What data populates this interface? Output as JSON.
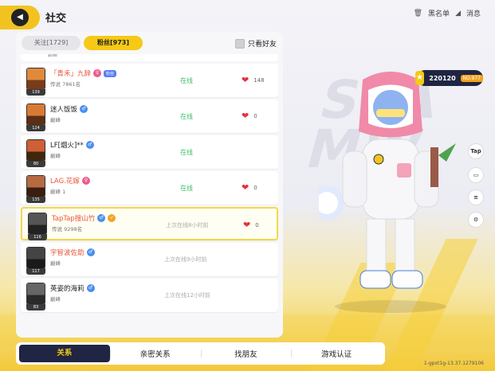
{
  "header": {
    "title": "社交",
    "blacklist_label": "黑名单",
    "messages_label": "消息"
  },
  "tabs": [
    {
      "label": "关注[1729]",
      "active": false
    },
    {
      "label": "粉丝[973]",
      "active": true
    }
  ],
  "friends_only_label": "只看好友",
  "partial_row": {
    "rank": "巅峰"
  },
  "rows": [
    {
      "name": "「青禾」九辞",
      "gender": "female",
      "badge": "粉丝",
      "level": "139",
      "rank": "传说 7861名",
      "status": "在线",
      "online": true,
      "likes": "148",
      "avatar_color": "#e08a3c",
      "name_color": "orange"
    },
    {
      "name": "迷人饭饭",
      "gender": "male",
      "badge": "",
      "level": "124",
      "rank": "巅峰",
      "status": "在线",
      "online": true,
      "likes": "0",
      "avatar_color": "#d97a34",
      "name_color": "dark"
    },
    {
      "name": "LF[烟火]**",
      "gender": "male",
      "badge": "",
      "level": "80",
      "rank": "巅峰",
      "status": "在线",
      "online": true,
      "likes": "",
      "avatar_color": "#cf5f34",
      "name_color": "dark"
    },
    {
      "name": "LAG.花嫁",
      "gender": "female",
      "badge": "",
      "level": "135",
      "rank": "巅峰 1",
      "status": "在线",
      "online": true,
      "likes": "0",
      "avatar_color": "#b76a42",
      "name_color": "orange"
    },
    {
      "name": "TapTap搜山竹",
      "gender": "male",
      "badge": "",
      "level": "116",
      "rank": "传说 9298名",
      "status": "上次在线8小时前",
      "online": false,
      "likes": "0",
      "avatar_color": "#555",
      "name_color": "orange",
      "highlight": true
    },
    {
      "name": "宇智波佐助",
      "gender": "male",
      "badge": "",
      "level": "117",
      "rank": "巅峰",
      "status": "上次在线9小时前",
      "online": false,
      "likes": "",
      "avatar_color": "#444",
      "name_color": "orange"
    },
    {
      "name": "英姿的海莉",
      "gender": "male",
      "badge": "",
      "level": "83",
      "rank": "巅峰",
      "status": "上次在线12小时前",
      "online": false,
      "likes": "",
      "avatar_color": "#666",
      "name_color": "dark"
    }
  ],
  "score": {
    "value": "220120",
    "no": "NO.977"
  },
  "side_buttons": [
    {
      "label": "Tap",
      "icon": "taptap-icon"
    },
    {
      "label": "",
      "icon": "chat-bubble-icon"
    },
    {
      "label": "",
      "icon": "document-icon"
    },
    {
      "label": "",
      "icon": "settings-gear-icon"
    }
  ],
  "bottom_nav": [
    {
      "label": "关系",
      "active": true
    },
    {
      "label": "亲密关系",
      "active": false
    },
    {
      "label": "找朋友",
      "active": false
    },
    {
      "label": "游戏认证",
      "active": false
    }
  ],
  "version": "1-gpxt1g-13.37.1279106",
  "colors": {
    "accent": "#f6c915",
    "dark_nav": "#1f2542",
    "online": "#3fbf6a",
    "heart": "#e6303a"
  }
}
